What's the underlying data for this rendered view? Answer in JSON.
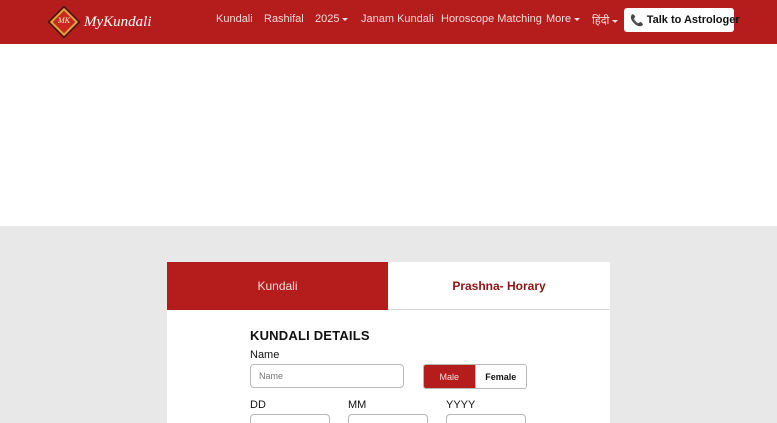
{
  "brand": {
    "name": "MyKundali",
    "mark": "MK"
  },
  "nav": {
    "items": [
      {
        "label": "Kundali"
      },
      {
        "label": "Rashifal"
      },
      {
        "label": "2025"
      },
      {
        "label": "Janam Kundali"
      },
      {
        "label": "Horoscope Matching"
      },
      {
        "label": "More"
      },
      {
        "label": "हिंदी"
      }
    ],
    "cta_label": "Talk to Astrologer"
  },
  "tabs": [
    {
      "label": "Kundali",
      "active": true
    },
    {
      "label": "Prashna- Horary",
      "active": false
    }
  ],
  "form": {
    "title": "KUNDALI DETAILS",
    "name_label": "Name",
    "name_placeholder": "Name",
    "gender_options": [
      "Male",
      "Female"
    ],
    "gender_selected": "Male",
    "dd_label": "DD",
    "mm_label": "MM",
    "yyyy_label": "YYYY"
  },
  "colors": {
    "brand_red": "#b51c1c",
    "background_gray": "#e8e8e8"
  }
}
